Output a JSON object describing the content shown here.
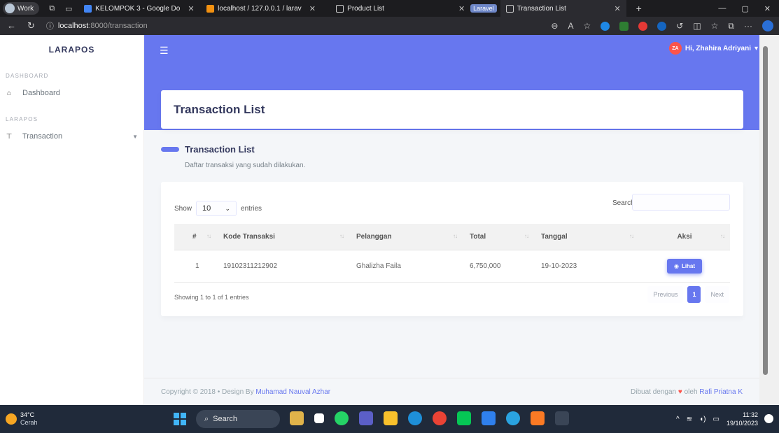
{
  "browser": {
    "profile": "Work",
    "tabs": [
      {
        "title": "KELOMPOK 3 - Google Do",
        "fav_color": "#4285f4"
      },
      {
        "title": "localhost / 127.0.0.1 / larav",
        "fav_color": "#f29111"
      },
      {
        "title": "Product List",
        "fav_color": "#cccccc"
      },
      {
        "group": "Laravel"
      },
      {
        "title": "Transaction List",
        "fav_color": "#cccccc"
      }
    ],
    "url_host": "localhost",
    "url_path": ":8000/transaction"
  },
  "sidebar": {
    "brand": "LARAPOS",
    "sections": [
      {
        "header": "DASHBOARD",
        "item": "Dashboard",
        "icon": "home-icon"
      },
      {
        "header": "LARAPOS",
        "item": "Transaction",
        "icon": "cart-icon"
      }
    ]
  },
  "navbar": {
    "avatar_initials": "ZA",
    "greeting": "Hi, Zhahira Adriyani"
  },
  "page": {
    "title": "Transaction List",
    "section_title": "Transaction List",
    "section_lead": "Daftar transaksi yang sudah dilakukan."
  },
  "table": {
    "show_label": "Show",
    "entries_value": "10",
    "entries_label": "entries",
    "search_label": "Search:",
    "columns": [
      "#",
      "Kode Transaksi",
      "Pelanggan",
      "Total",
      "Tanggal",
      "Aksi"
    ],
    "rows": [
      {
        "no": "1",
        "kode": "19102311212902",
        "pelanggan": "Ghalizha Faila",
        "total": "6,750,000",
        "tanggal": "19-10-2023",
        "aksi": "Lihat"
      }
    ],
    "info": "Showing 1 to 1 of 1 entries",
    "prev": "Previous",
    "page": "1",
    "next": "Next"
  },
  "footer": {
    "left_text": "Copyright © 2018 • Design By ",
    "left_link": "Muhamad Nauval Azhar",
    "right_text": "Dibuat dengan ",
    "right_mid": " oleh ",
    "right_link": "Rafi Priatna K"
  },
  "taskbar": {
    "temp": "34°C",
    "weather": "Cerah",
    "search": "Search",
    "time": "11:32",
    "date": "19/10/2023"
  },
  "colors": {
    "primary": "#6777ef",
    "danger": "#fc544b"
  }
}
